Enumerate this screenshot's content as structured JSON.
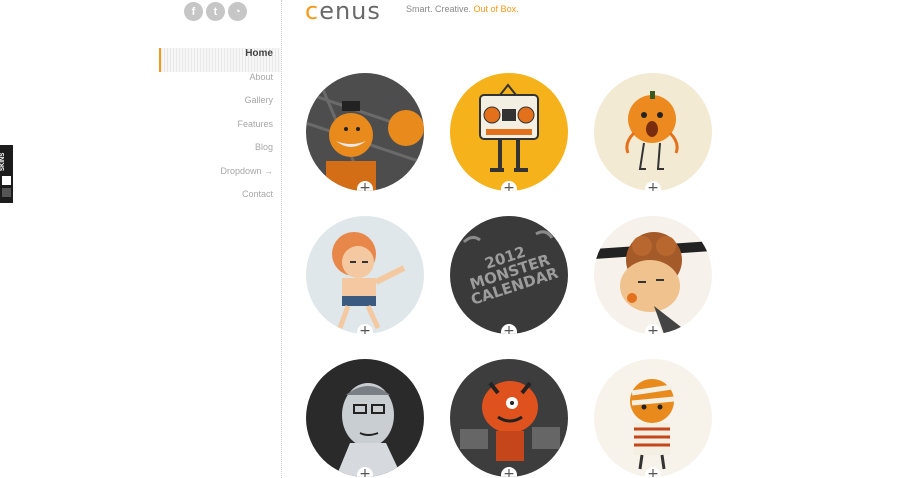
{
  "social": [
    {
      "name": "facebook",
      "glyph": "f"
    },
    {
      "name": "twitter",
      "glyph": "t"
    },
    {
      "name": "rss",
      "glyph": "◔"
    }
  ],
  "brand": {
    "logo_first": "c",
    "logo_rest": "enus",
    "tagline_prefix": "Smart. Creative.",
    "tagline_accent": "Out of Box.",
    "accent_color": "#f39a1a"
  },
  "nav": [
    "Home",
    "About",
    "Gallery",
    "Features",
    "Blog",
    "Dropdown →",
    "Contact"
  ],
  "skins": {
    "label": "SKINS"
  },
  "gallery": {
    "plus_label": "+",
    "items": [
      {
        "name": "mustache-bandit",
        "bg": "#4a4a4a"
      },
      {
        "name": "boombox",
        "bg": "#f6b21b"
      },
      {
        "name": "scared-pumpkin",
        "bg": "#f3ead4"
      },
      {
        "name": "sleepy-kid",
        "bg": "#dfe7ea"
      },
      {
        "name": "monster-calendar",
        "bg": "#3a3a3a",
        "lines": [
          "2012",
          "MONSTER",
          "CALENDAR"
        ]
      },
      {
        "name": "curly-hair-guy",
        "bg": "#f6f1ea"
      },
      {
        "name": "skeptical-man",
        "bg": "#2a2a2a"
      },
      {
        "name": "angry-monster",
        "bg": "#3d3d3d"
      },
      {
        "name": "striped-mummy",
        "bg": "#f7f3ea"
      }
    ]
  }
}
